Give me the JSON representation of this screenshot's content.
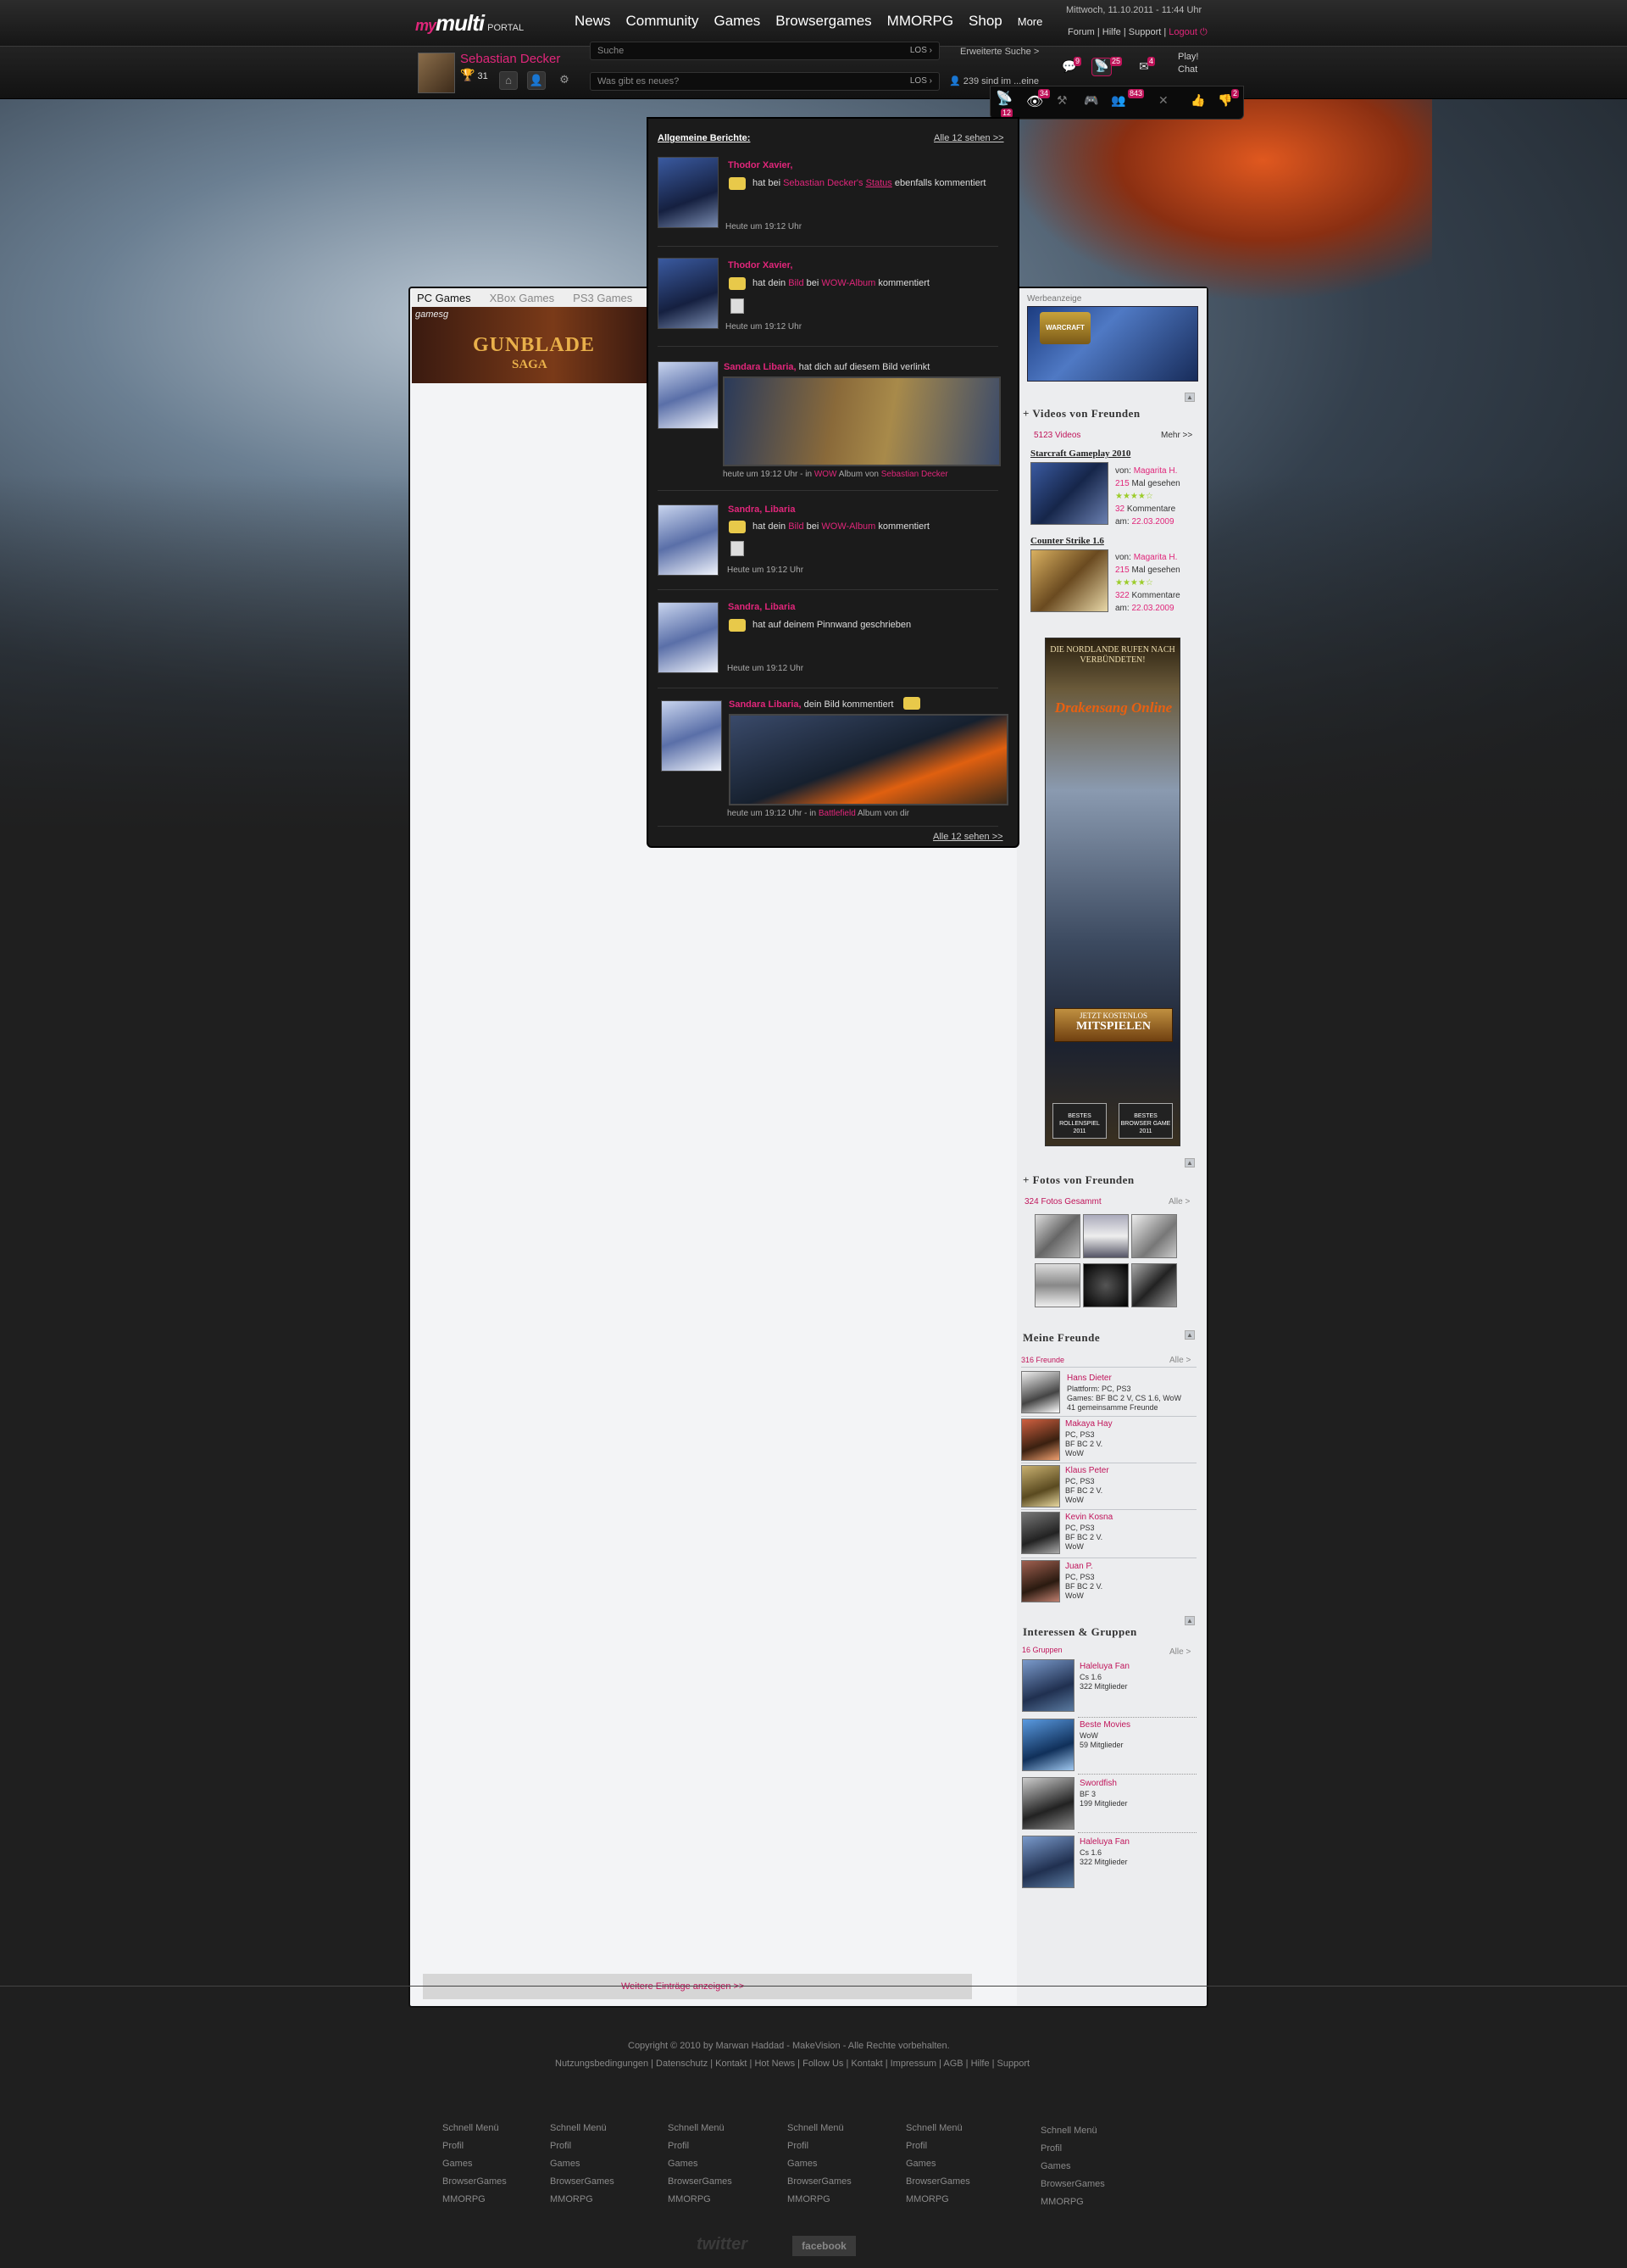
{
  "header": {
    "logo_my": "my",
    "logo_main": "multi",
    "logo_portal": "PORTAL",
    "nav": [
      "News",
      "Community",
      "Games",
      "Browsergames",
      "MMORPG",
      "Shop",
      "More"
    ],
    "date": "Mittwoch, 11.10.2011 - 11:44 Uhr",
    "links": {
      "forum": "Forum",
      "hilfe": "Hilfe",
      "support": "Support",
      "logout": "Logout"
    }
  },
  "user": {
    "name": "Sebastian Decker",
    "points": "31"
  },
  "search": {
    "placeholder": "Suche",
    "go": "LOS",
    "status_placeholder": "Was gibt es neues?",
    "status_go": "LOS",
    "advanced": "Erweiterte Suche >",
    "friends_online": "239 sind im ...eine"
  },
  "toolbar": {
    "counts": {
      "messages": "9",
      "notifications": "25",
      "mail": "4",
      "eye": "34",
      "friends": "843",
      "thumbs_down": "2"
    },
    "strip_counts": {
      "notif": "12"
    },
    "play": "Play!",
    "chat": "Chat"
  },
  "tabs": [
    "PC Games",
    "XBox Games",
    "PS3 Games"
  ],
  "gunblade": {
    "brand": "gamesg",
    "title": "GUNBLADE",
    "subtitle": "SAGA"
  },
  "notifications": {
    "title": "Allgemeine Berichte:",
    "see_all": "Alle 12 sehen >>",
    "items": [
      {
        "name": "Thodor Xavier,",
        "t1": "hat bei",
        "l1": "Sebastian Decker's",
        "l2": "Status",
        "t2": "ebenfalls kommentiert",
        "time": "Heute um 19:12 Uhr"
      },
      {
        "name": "Thodor Xavier,",
        "t1": "hat dein",
        "l1": "Bild",
        "t_mid": "bei",
        "l2": "WOW-Album",
        "t2": "kommentiert",
        "time": "Heute um 19:12 Uhr"
      },
      {
        "name": "Sandara Libaria,",
        "t1": "hat dich auf diesem Bild verlinkt",
        "time_prefix": "heute um 19:12 Uhr - in",
        "l1": "WOW",
        "t_mid": "Album von",
        "l2": "Sebastian Decker"
      },
      {
        "name": "Sandra, Libaria",
        "t1": "hat dein",
        "l1": "Bild",
        "t_mid": "bei",
        "l2": "WOW-Album",
        "t2": "kommentiert",
        "time": "Heute um 19:12 Uhr"
      },
      {
        "name": "Sandra, Libaria",
        "t1": "hat auf deinem Pinnwand geschrieben",
        "time": "Heute um 19:12 Uhr"
      },
      {
        "name": "Sandara Libaria,",
        "t1": "dein Bild kommentiert",
        "time_prefix": "heute um 19:12 Uhr - in",
        "l1": "Battlefield",
        "t_mid": "Album von dir"
      }
    ]
  },
  "right": {
    "ad_label": "Werbeanzeige",
    "wow_logo": "WARCRAFT",
    "videos": {
      "title": "+ Videos von Freunden",
      "count": "5123 Videos",
      "more": "Mehr >>",
      "items": [
        {
          "title": "Starcraft Gameplay 2010",
          "from_label": "von:",
          "from": "Magarita H.",
          "views": "215",
          "views_label": "Mal gesehen",
          "rating": 4,
          "comments": "32",
          "comments_label": "Kommentare",
          "date_label": "am:",
          "date": "22.03.2009"
        },
        {
          "title": "Counter Strike 1.6",
          "from_label": "von:",
          "from": "Magarita H.",
          "views": "215",
          "views_label": "Mal gesehen",
          "rating": 4,
          "comments": "322",
          "comments_label": "Kommentare",
          "date_label": "am:",
          "date": "22.03.2009"
        }
      ]
    },
    "drakensang": {
      "header": "DIE NORDLANDE RUFEN NACH VERBÜNDETEN!",
      "logo": "Drakensang Online",
      "cta_top": "JETZT KOSTENLOS",
      "cta": "MITSPIELEN",
      "award1": "BESTES ROLLENSPIEL 2011",
      "award2": "BESTES BROWSER GAME 2011"
    },
    "photos": {
      "title": "+ Fotos von Freunden",
      "count": "324 Fotos Gesammt",
      "all": "Alle >"
    },
    "friends": {
      "title": "Meine Freunde",
      "count": "316 Freunde",
      "all": "Alle >",
      "items": [
        {
          "name": "Hans Dieter",
          "lines": [
            "Plattform: PC, PS3",
            "Games: BF BC 2 V, CS 1.6, WoW",
            "41 gemeinsamme Freunde"
          ]
        },
        {
          "name": "Makaya Hay",
          "lines": [
            "PC, PS3",
            "BF BC 2 V.",
            "WoW"
          ]
        },
        {
          "name": "Klaus Peter",
          "lines": [
            "PC, PS3",
            "BF BC 2 V.",
            "WoW"
          ]
        },
        {
          "name": "Kevin Kosna",
          "lines": [
            "PC, PS3",
            "BF BC 2 V.",
            "WoW"
          ]
        },
        {
          "name": "Juan P.",
          "lines": [
            "PC, PS3",
            "BF BC 2 V.",
            "WoW"
          ]
        }
      ]
    },
    "groups": {
      "title": "Interessen & Gruppen",
      "count": "16 Gruppen",
      "all": "Alle >",
      "items": [
        {
          "name": "Haleluya Fan",
          "game": "Cs 1.6",
          "members": "322 Mitglieder"
        },
        {
          "name": "Beste Movies",
          "game": "WoW",
          "members": "59 Mitglieder"
        },
        {
          "name": "Swordfish",
          "game": "BF 3",
          "members": "199 Mitglieder"
        },
        {
          "name": "Haleluya Fan",
          "game": "Cs 1.6",
          "members": "322 Mitglieder"
        }
      ]
    }
  },
  "more_entries": "Weitere Einträge anzeigen >>",
  "footer": {
    "copyright": "Copyright © 2010 by Marwan Haddad - MakeVision -  Alle Rechte vorbehalten.",
    "links": "Nutzungsbedingungen | Datenschutz | Kontakt | Hot News | Follow Us | Kontakt | Impressum | AGB | Hilfe | Support",
    "columns": [
      [
        "Schnell Menü",
        "Profil",
        "Games",
        "BrowserGames",
        "MMORPG"
      ],
      [
        "Schnell Menü",
        "Profil",
        "Games",
        "BrowserGames",
        "MMORPG"
      ],
      [
        "Schnell Menü",
        "Profil",
        "Games",
        "BrowserGames",
        "MMORPG"
      ],
      [
        "Schnell Menü",
        "Profil",
        "Games",
        "BrowserGames",
        "MMORPG"
      ],
      [
        "Schnell Menü",
        "Profil",
        "Games",
        "BrowserGames",
        "MMORPG"
      ],
      [
        "Schnell Menü",
        "Profil",
        "Games",
        "BrowserGames",
        "MMORPG"
      ]
    ],
    "twitter": "twitter",
    "facebook": "facebook"
  },
  "colors": {
    "accent": "#e0267a",
    "link_dark": "#c0145a",
    "bg": "#1f1f1f",
    "panel": "#f3f4f6"
  }
}
